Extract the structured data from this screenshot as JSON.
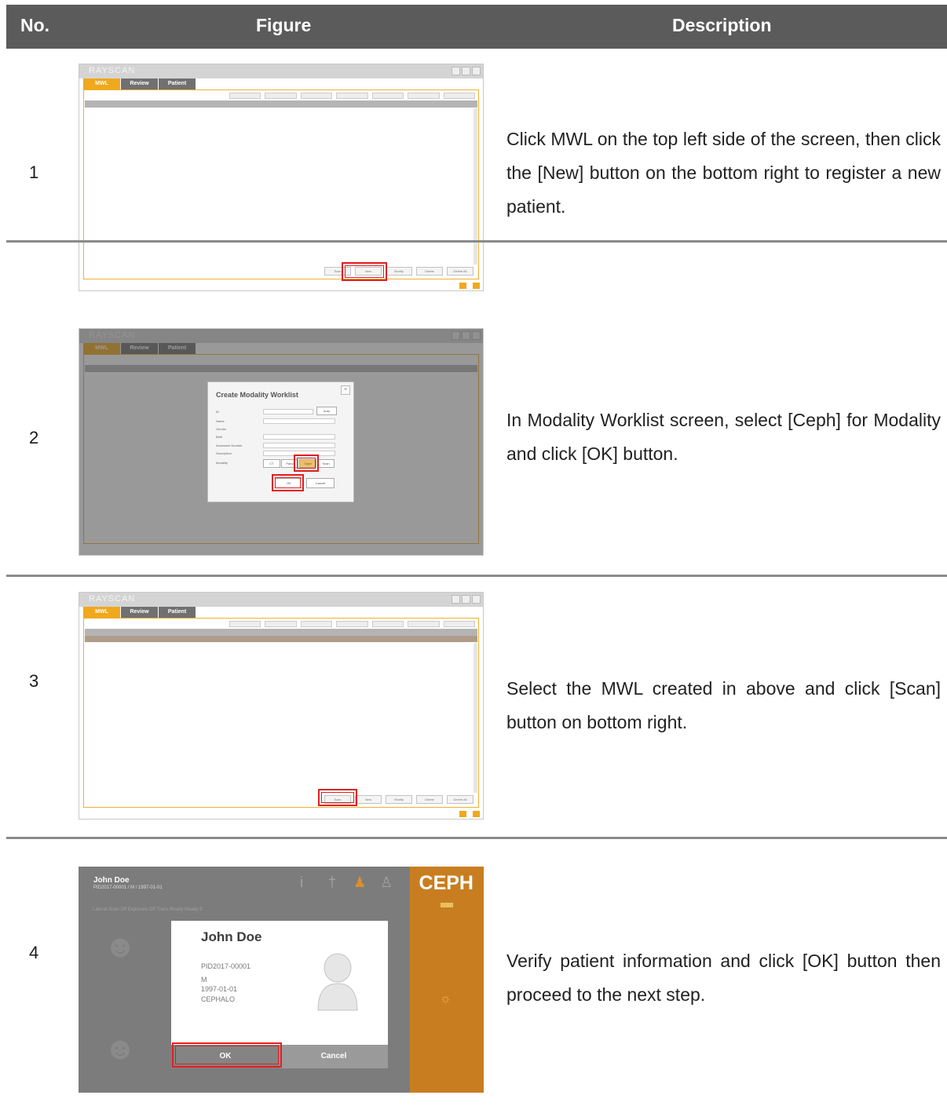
{
  "header": {
    "no": "No.",
    "figure": "Figure",
    "description": "Description"
  },
  "rows": [
    {
      "no": "1",
      "description": "Click MWL on the top left side of the screen, then click the [New] button on the bottom right to register a new patient."
    },
    {
      "no": "2",
      "description": "In Modality Worklist screen, select [Ceph] for Modality and click [OK] button."
    },
    {
      "no": "3",
      "description": "Select the MWL created in above and click [Scan] button on bottom right."
    },
    {
      "no": "4",
      "description": "Verify patient information and click [OK] button then proceed to the next step."
    }
  ],
  "app": {
    "brand": "RAYSCAN",
    "tabs": [
      "MWL",
      "Review",
      "Patient"
    ],
    "buttons_row1": [
      "Scan",
      "New",
      "Modify",
      "Delete",
      "Delete All"
    ],
    "buttons_row3": [
      "Scan",
      "New",
      "Modify",
      "Delete",
      "Delete All"
    ],
    "dialog": {
      "title": "Create Modality Worklist",
      "fields": [
        "ID",
        "Name",
        "Gender",
        "Birth",
        "Accession Number",
        "Description",
        "Modality"
      ],
      "modality_options": [
        "CT",
        "Pano",
        "Ceph",
        "Scan"
      ],
      "auto": "Auto",
      "ok": "OK",
      "cancel": "Cancel"
    }
  },
  "console": {
    "patient_name": "John Doe",
    "patient_info": "PID2017-00001 / M / 1997-01-01",
    "status_line": "Lateral  Scan Off  Exposure Off  Trans Ready  Ready  E",
    "mode_label": "CEPH",
    "modal": {
      "name": "John Doe",
      "lines": [
        "PID2017-00001",
        "M",
        "1997-01-01",
        "CEPHALO"
      ],
      "ok": "OK",
      "cancel": "Cancel"
    }
  },
  "colors": {
    "accent": "#f0a81c",
    "highlight": "#e02020",
    "header_bg": "#5b5b5b"
  }
}
